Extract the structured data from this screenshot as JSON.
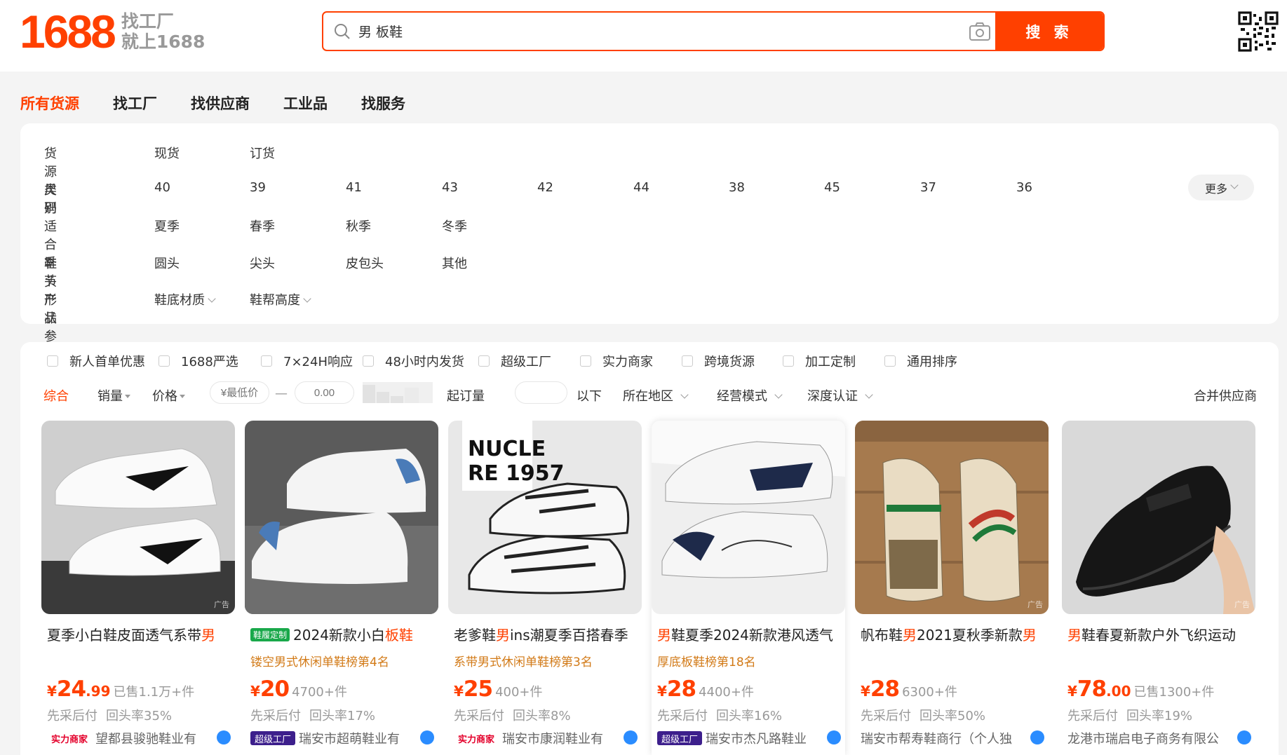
{
  "brand": {
    "logo_text": "1688",
    "slogan_line1": "找工厂",
    "slogan_line2": "就上1688"
  },
  "search": {
    "query": "男 板鞋",
    "button": "搜 索"
  },
  "tabs": [
    "所有货源",
    "找工厂",
    "找供应商",
    "工业品",
    "找服务"
  ],
  "filters": {
    "source_type": {
      "label": "货源类别",
      "options": [
        "现货",
        "订货"
      ]
    },
    "size": {
      "label": "尺码",
      "options": [
        "40",
        "39",
        "41",
        "43",
        "42",
        "44",
        "38",
        "45",
        "37",
        "36"
      ],
      "more": "更多"
    },
    "season": {
      "label": "适合季节",
      "options": [
        "夏季",
        "春季",
        "秋季",
        "冬季"
      ]
    },
    "toe_shape": {
      "label": "鞋头形状",
      "options": [
        "圆头",
        "尖头",
        "皮包头",
        "其他"
      ]
    },
    "params": {
      "label": "产品参数",
      "options": [
        "鞋底材质",
        "鞋帮高度"
      ]
    }
  },
  "checkboxes": [
    "新人首单优惠",
    "1688严选",
    "7×24H响应",
    "48小时内发货",
    "超级工厂",
    "实力商家",
    "跨境货源",
    "加工定制",
    "通用排序"
  ],
  "sort": {
    "comprehensive": "综合",
    "sales": "销量",
    "price": "价格",
    "min_price_placeholder": "¥最低价",
    "dash": "—",
    "max_price_placeholder": "0.00",
    "moq_label": "起订量",
    "moq_suffix": "以下",
    "region": "所在地区",
    "biz_mode": "经营模式",
    "depth_cert": "深度认证",
    "merge": "合并供应商"
  },
  "products": [
    {
      "title_pre": "夏季小白鞋皮面透气系带",
      "title_hl": "男",
      "title_post": "",
      "tag": "",
      "rank": "",
      "currency": "¥",
      "price": "24",
      "price_dec": ".99",
      "sold": "已售1.1万+件",
      "meta1": "先采后付",
      "meta2": "回头率35%",
      "badge": "实力商家",
      "badge_type": "shili",
      "shop": "望都县骏驰鞋业有"
    },
    {
      "title_pre": "2024新款小白",
      "title_hl": "板鞋",
      "title_post": "",
      "tag": "鞋履定制",
      "rank": "镂空男式休闲单鞋榜第4名",
      "currency": "¥",
      "price": "20",
      "price_dec": "",
      "sold": "4700+件",
      "meta1": "先采后付",
      "meta2": "回头率17%",
      "badge": "超级工厂",
      "badge_type": "chaoji",
      "shop": "瑞安市超萌鞋业有"
    },
    {
      "title_pre": "老爹鞋",
      "title_hl": "男",
      "title_post": "ins潮夏季百搭春季",
      "tag": "",
      "rank": "系带男式休闲单鞋榜第3名",
      "currency": "¥",
      "price": "25",
      "price_dec": "",
      "sold": "400+件",
      "meta1": "先采后付",
      "meta2": "回头率8%",
      "badge": "实力商家",
      "badge_type": "shili",
      "shop": "瑞安市康润鞋业有"
    },
    {
      "title_pre": "",
      "title_hl": "男",
      "title_post": "鞋夏季2024新款港风透气",
      "tag": "",
      "rank": "厚底板鞋榜第18名",
      "currency": "¥",
      "price": "28",
      "price_dec": "",
      "sold": "4400+件",
      "meta1": "先采后付",
      "meta2": "回头率16%",
      "badge": "超级工厂",
      "badge_type": "chaoji",
      "shop": "瑞安市杰凡路鞋业"
    },
    {
      "title_pre": "帆布鞋",
      "title_hl": "男",
      "title_post": "2021夏秋季新款",
      "title_hl2": "男",
      "tag": "",
      "rank": "",
      "currency": "¥",
      "price": "28",
      "price_dec": "",
      "sold": "6300+件",
      "meta1": "先采后付",
      "meta2": "回头率50%",
      "badge": "",
      "badge_type": "",
      "shop": "瑞安市帮寿鞋商行（个人独"
    },
    {
      "title_pre": "",
      "title_hl": "男",
      "title_post": "鞋春夏新款户外飞织运动",
      "tag": "",
      "rank": "",
      "currency": "¥",
      "price": "78",
      "price_dec": ".00",
      "sold": "已售1300+件",
      "meta1": "先采后付",
      "meta2": "回头率19%",
      "badge": "",
      "badge_type": "",
      "shop": "龙港市瑞启电子商务有限公"
    }
  ],
  "ad_label": "广告"
}
